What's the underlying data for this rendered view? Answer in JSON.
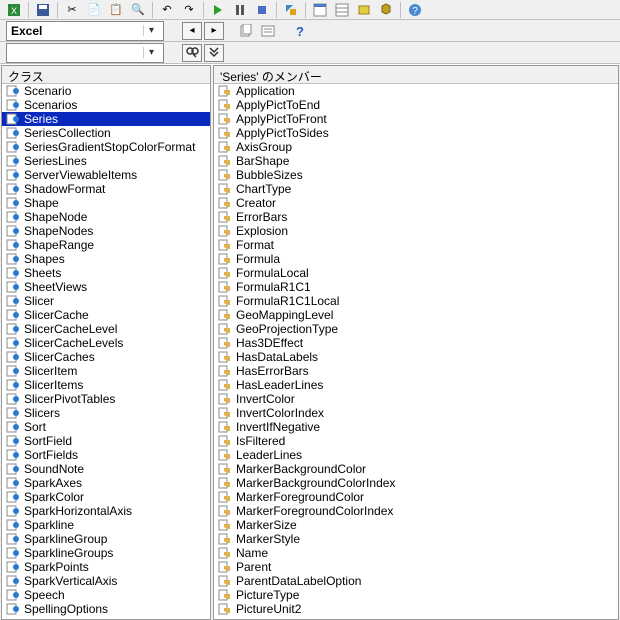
{
  "toolbar2": {
    "library_dropdown": "Excel"
  },
  "toolbar3": {
    "class_dropdown": ""
  },
  "leftPanel": {
    "title": "クラス",
    "selectedIndex": 2,
    "items": [
      "Scenario",
      "Scenarios",
      "Series",
      "SeriesCollection",
      "SeriesGradientStopColorFormat",
      "SeriesLines",
      "ServerViewableItems",
      "ShadowFormat",
      "Shape",
      "ShapeNode",
      "ShapeNodes",
      "ShapeRange",
      "Shapes",
      "Sheets",
      "SheetViews",
      "Slicer",
      "SlicerCache",
      "SlicerCacheLevel",
      "SlicerCacheLevels",
      "SlicerCaches",
      "SlicerItem",
      "SlicerItems",
      "SlicerPivotTables",
      "Slicers",
      "Sort",
      "SortField",
      "SortFields",
      "SoundNote",
      "SparkAxes",
      "SparkColor",
      "SparkHorizontalAxis",
      "Sparkline",
      "SparklineGroup",
      "SparklineGroups",
      "SparkPoints",
      "SparkVerticalAxis",
      "Speech",
      "SpellingOptions"
    ]
  },
  "rightPanel": {
    "title": "'Series' のメンバー",
    "items": [
      {
        "name": "Application",
        "kind": "prop"
      },
      {
        "name": "ApplyPictToEnd",
        "kind": "prop"
      },
      {
        "name": "ApplyPictToFront",
        "kind": "prop"
      },
      {
        "name": "ApplyPictToSides",
        "kind": "prop"
      },
      {
        "name": "AxisGroup",
        "kind": "prop"
      },
      {
        "name": "BarShape",
        "kind": "prop"
      },
      {
        "name": "BubbleSizes",
        "kind": "prop"
      },
      {
        "name": "ChartType",
        "kind": "prop"
      },
      {
        "name": "Creator",
        "kind": "prop"
      },
      {
        "name": "ErrorBars",
        "kind": "prop"
      },
      {
        "name": "Explosion",
        "kind": "prop"
      },
      {
        "name": "Format",
        "kind": "prop"
      },
      {
        "name": "Formula",
        "kind": "prop"
      },
      {
        "name": "FormulaLocal",
        "kind": "prop"
      },
      {
        "name": "FormulaR1C1",
        "kind": "prop"
      },
      {
        "name": "FormulaR1C1Local",
        "kind": "prop"
      },
      {
        "name": "GeoMappingLevel",
        "kind": "prop"
      },
      {
        "name": "GeoProjectionType",
        "kind": "prop"
      },
      {
        "name": "Has3DEffect",
        "kind": "prop"
      },
      {
        "name": "HasDataLabels",
        "kind": "prop"
      },
      {
        "name": "HasErrorBars",
        "kind": "prop"
      },
      {
        "name": "HasLeaderLines",
        "kind": "prop"
      },
      {
        "name": "InvertColor",
        "kind": "prop"
      },
      {
        "name": "InvertColorIndex",
        "kind": "prop"
      },
      {
        "name": "InvertIfNegative",
        "kind": "prop"
      },
      {
        "name": "IsFiltered",
        "kind": "prop"
      },
      {
        "name": "LeaderLines",
        "kind": "prop"
      },
      {
        "name": "MarkerBackgroundColor",
        "kind": "prop"
      },
      {
        "name": "MarkerBackgroundColorIndex",
        "kind": "prop"
      },
      {
        "name": "MarkerForegroundColor",
        "kind": "prop"
      },
      {
        "name": "MarkerForegroundColorIndex",
        "kind": "prop"
      },
      {
        "name": "MarkerSize",
        "kind": "prop"
      },
      {
        "name": "MarkerStyle",
        "kind": "prop"
      },
      {
        "name": "Name",
        "kind": "prop"
      },
      {
        "name": "Parent",
        "kind": "prop"
      },
      {
        "name": "ParentDataLabelOption",
        "kind": "prop"
      },
      {
        "name": "PictureType",
        "kind": "prop"
      },
      {
        "name": "PictureUnit2",
        "kind": "prop"
      }
    ]
  }
}
